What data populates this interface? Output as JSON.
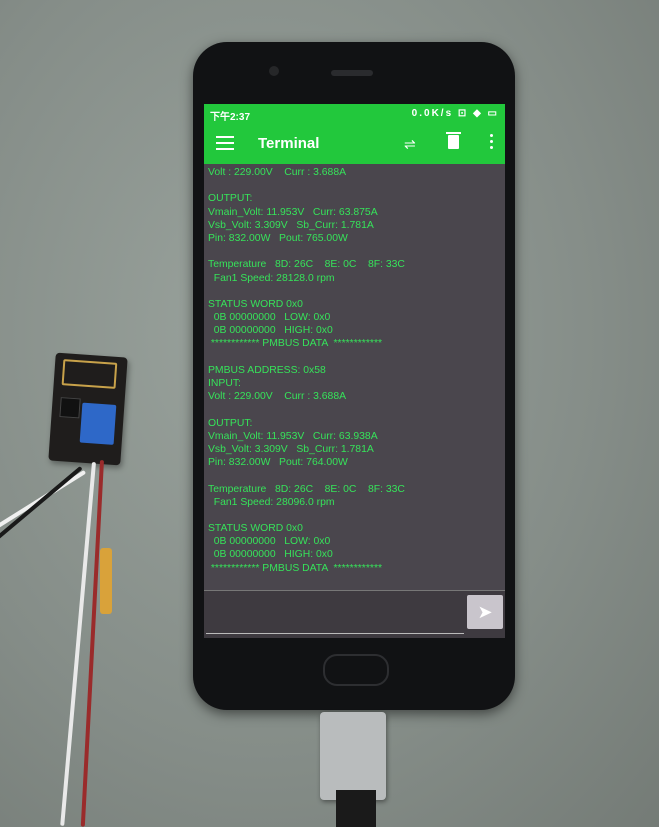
{
  "status_bar": {
    "time": "下午2:37",
    "indicators": "0.0K/s ⊡ ◆ ▭"
  },
  "toolbar": {
    "title": "Terminal",
    "menu_icon": "hamburger-menu-icon",
    "connect_icon": "connect-icon",
    "delete_icon": "trash-icon",
    "more_icon": "more-vert-icon"
  },
  "terminal_lines": [
    "Volt : 229.00V    Curr : 3.688A",
    "",
    "OUTPUT:",
    "Vmain_Volt: 11.953V   Curr: 63.875A",
    "Vsb_Volt: 3.309V   Sb_Curr: 1.781A",
    "Pin: 832.00W   Pout: 765.00W",
    "",
    "Temperature   8D: 26C    8E: 0C    8F: 33C",
    "  Fan1 Speed: 28128.0 rpm",
    "",
    "STATUS WORD 0x0",
    "  0B 00000000   LOW: 0x0",
    "  0B 00000000   HIGH: 0x0",
    " ************ PMBUS DATA  ************",
    "",
    "PMBUS ADDRESS: 0x58",
    "INPUT:",
    "Volt : 229.00V    Curr : 3.688A",
    "",
    "OUTPUT:",
    "Vmain_Volt: 11.953V   Curr: 63.938A",
    "Vsb_Volt: 3.309V   Sb_Curr: 1.781A",
    "Pin: 832.00W   Pout: 764.00W",
    "",
    "Temperature   8D: 26C    8E: 0C    8F: 33C",
    "  Fan1 Speed: 28096.0 rpm",
    "",
    "STATUS WORD 0x0",
    "  0B 00000000   LOW: 0x0",
    "  0B 00000000   HIGH: 0x0",
    " ************ PMBUS DATA  ************"
  ],
  "input": {
    "value": "",
    "placeholder": ""
  },
  "send_icon": "send-icon",
  "colors": {
    "toolbar": "#22c83c",
    "terminal_text": "#36e35a",
    "terminal_bg": "#4a464d"
  }
}
